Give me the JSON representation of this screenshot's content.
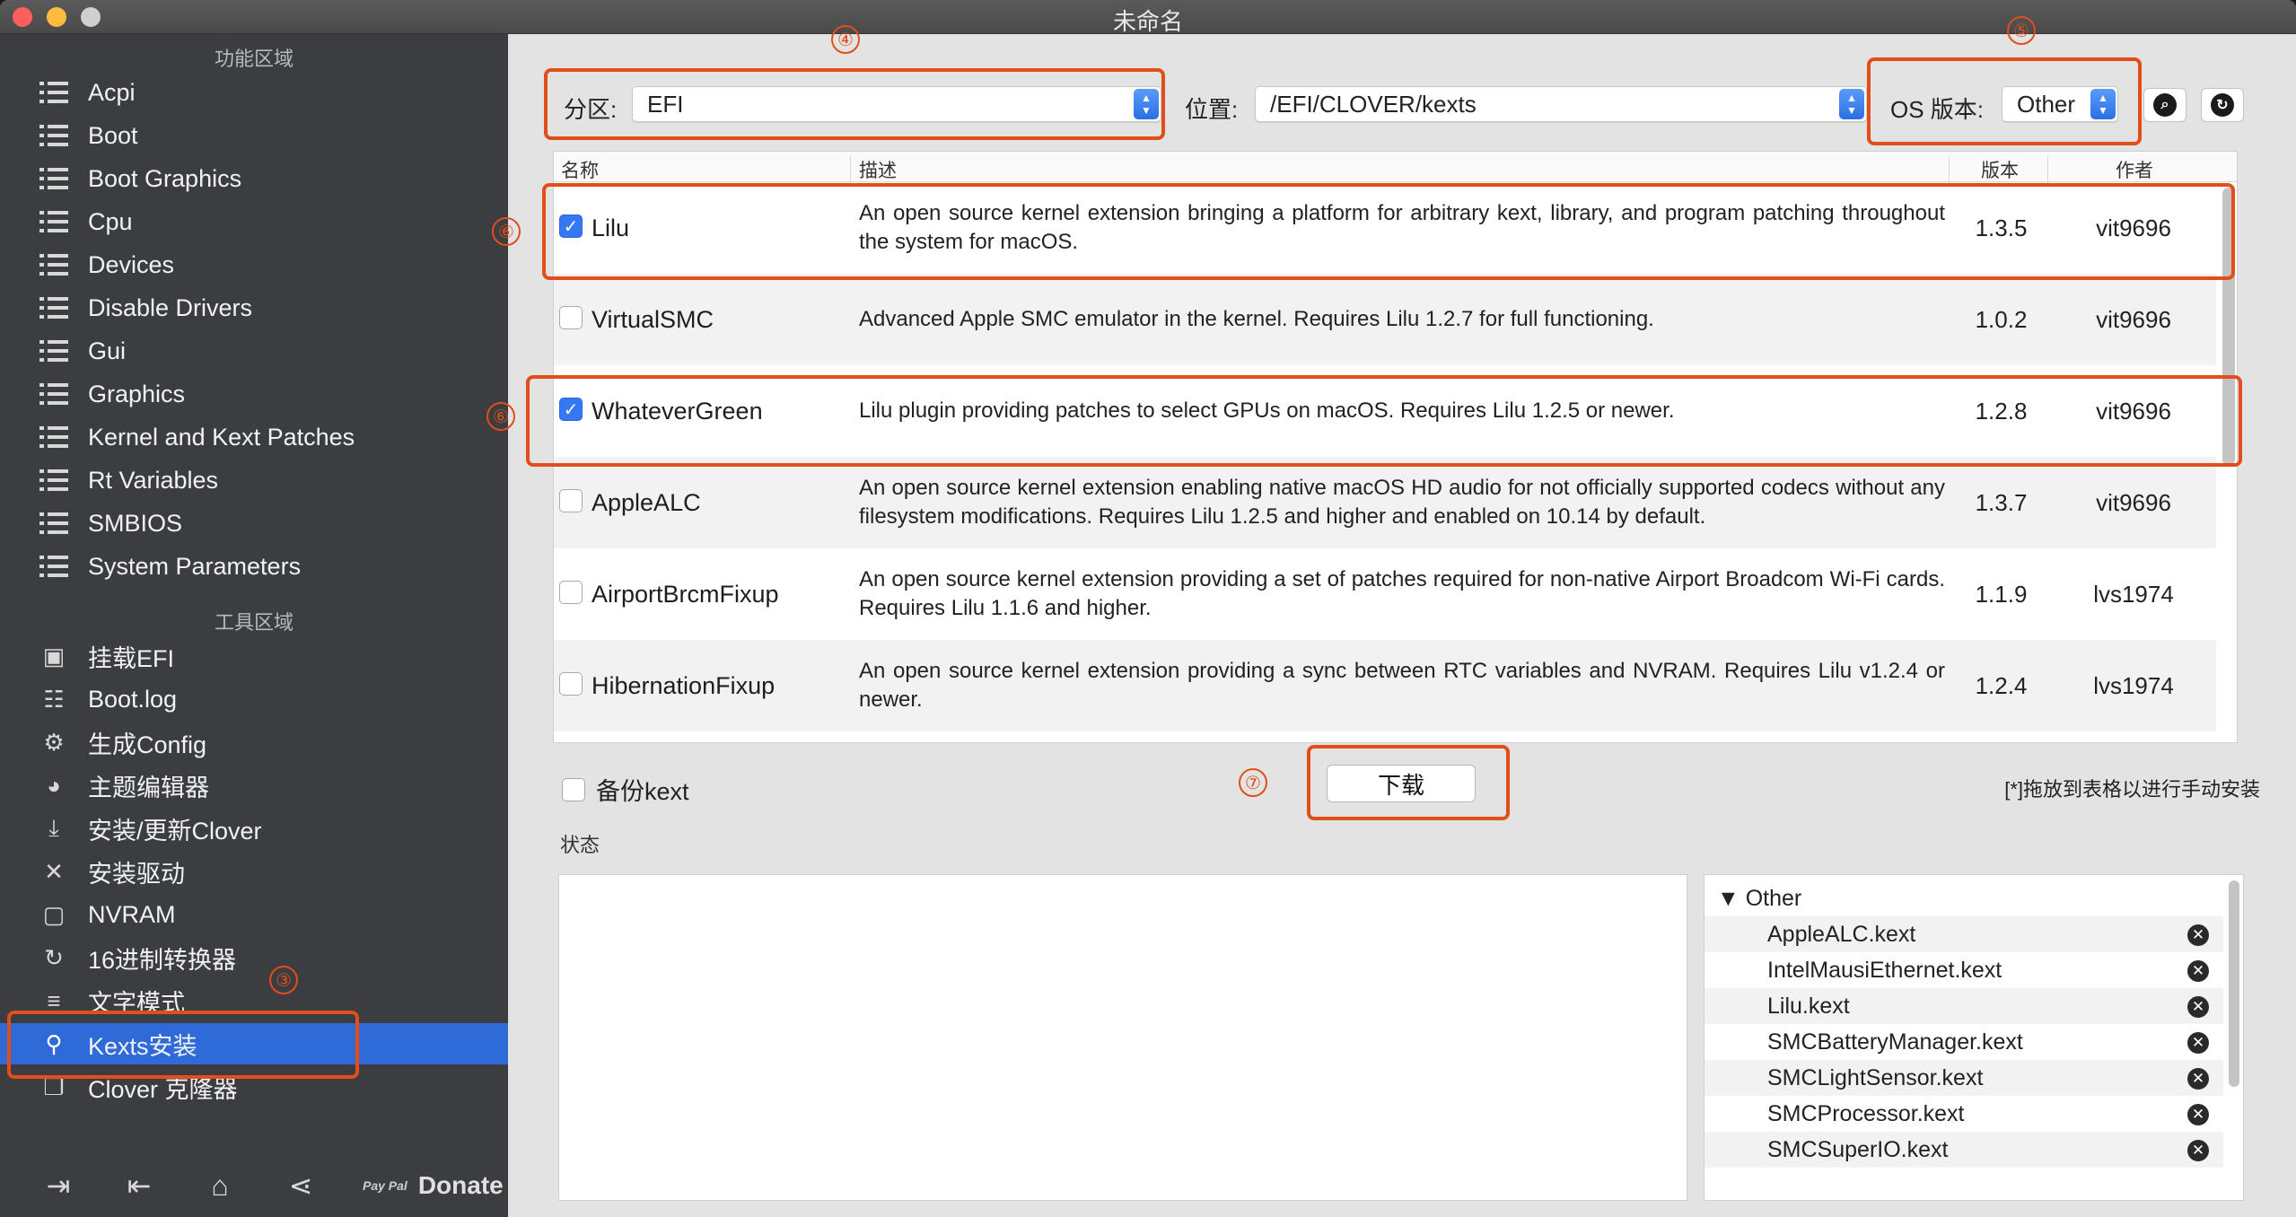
{
  "window": {
    "title": "未命名"
  },
  "sidebar": {
    "section1_title": "功能区域",
    "items": [
      {
        "label": "Acpi"
      },
      {
        "label": "Boot"
      },
      {
        "label": "Boot Graphics"
      },
      {
        "label": "Cpu"
      },
      {
        "label": "Devices"
      },
      {
        "label": "Disable Drivers"
      },
      {
        "label": "Gui"
      },
      {
        "label": "Graphics"
      },
      {
        "label": "Kernel and Kext Patches"
      },
      {
        "label": "Rt Variables"
      },
      {
        "label": "SMBIOS"
      },
      {
        "label": "System Parameters"
      }
    ],
    "section2_title": "工具区域",
    "tools": [
      {
        "label": "挂载EFI",
        "icon": "disk-icon"
      },
      {
        "label": "Boot.log",
        "icon": "log-icon"
      },
      {
        "label": "生成Config",
        "icon": "gears-icon"
      },
      {
        "label": "主题编辑器",
        "icon": "palette-icon"
      },
      {
        "label": "安装/更新Clover",
        "icon": "download-icon"
      },
      {
        "label": "安装驱动",
        "icon": "tools-icon"
      },
      {
        "label": "NVRAM",
        "icon": "chip-icon"
      },
      {
        "label": "16进制转换器",
        "icon": "refresh-icon"
      },
      {
        "label": "文字模式",
        "icon": "text-icon"
      },
      {
        "label": "Kexts安装",
        "icon": "plug-icon",
        "active": true
      },
      {
        "label": "Clover 克隆器",
        "icon": "clone-icon"
      }
    ],
    "donate_label": "Donate",
    "paypal_label": "Pay Pal"
  },
  "toolbar": {
    "partition_label": "分区:",
    "partition_value": "EFI",
    "location_label": "位置:",
    "location_value": "/EFI/CLOVER/kexts",
    "os_label": "OS 版本:",
    "os_value": "Other"
  },
  "table": {
    "headers": {
      "name": "名称",
      "desc": "描述",
      "version": "版本",
      "author": "作者"
    },
    "rows": [
      {
        "checked": true,
        "name": "Lilu",
        "desc": "An open source kernel extension bringing a platform for arbitrary kext, library, and program patching throughout the system for macOS.",
        "version": "1.3.5",
        "author": "vit9696"
      },
      {
        "checked": false,
        "name": "VirtualSMC",
        "desc": "Advanced Apple SMC emulator in the kernel. Requires Lilu 1.2.7 for full functioning.",
        "version": "1.0.2",
        "author": "vit9696"
      },
      {
        "checked": true,
        "name": "WhateverGreen",
        "desc": "Lilu plugin providing patches to select GPUs on macOS. Requires Lilu 1.2.5 or newer.",
        "version": "1.2.8",
        "author": "vit9696"
      },
      {
        "checked": false,
        "name": "AppleALC",
        "desc": "An open source kernel extension enabling native macOS HD audio for not officially supported codecs without any filesystem modifications. Requires Lilu 1.2.5 and higher and enabled on 10.14 by default.",
        "version": "1.3.7",
        "author": "vit9696"
      },
      {
        "checked": false,
        "name": "AirportBrcmFixup",
        "desc": "An open source kernel extension providing a set of patches required for non-native Airport Broadcom Wi-Fi cards. Requires Lilu 1.1.6 and higher.",
        "version": "1.1.9",
        "author": "lvs1974"
      },
      {
        "checked": false,
        "name": "HibernationFixup",
        "desc": "An open source kernel extension providing a sync between RTC variables and NVRAM. Requires Lilu v1.2.4 or newer.",
        "version": "1.2.4",
        "author": "lvs1974"
      }
    ]
  },
  "backup_label": "备份kext",
  "download_label": "下载",
  "drag_hint": "[*]拖放到表格以进行手动安装",
  "status_label": "状态",
  "tree": {
    "root": "Other",
    "items": [
      "AppleALC.kext",
      "IntelMausiEthernet.kext",
      "Lilu.kext",
      "SMCBatteryManager.kext",
      "SMCLightSensor.kext",
      "SMCProcessor.kext",
      "SMCSuperIO.kext"
    ]
  },
  "annotations": [
    "③",
    "④",
    "⑤",
    "⑥",
    "⑥",
    "⑦"
  ],
  "colors": {
    "accent": "#2f6ad9",
    "annotation": "#e14e1a",
    "sidebar_bg": "#3b3d40"
  }
}
